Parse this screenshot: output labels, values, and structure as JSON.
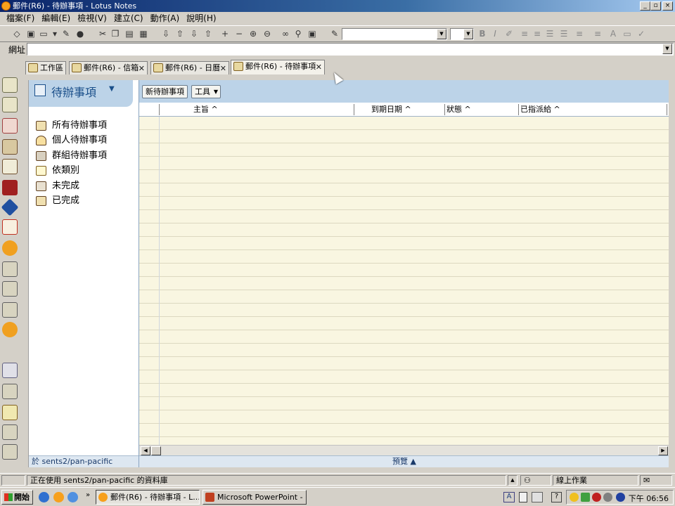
{
  "window": {
    "title": "郵件(R6) - 待辦事項 - Lotus Notes",
    "controls": [
      "_",
      "▫",
      "×"
    ]
  },
  "menu": [
    "檔案(F)",
    "編輯(E)",
    "檢視(V)",
    "建立(C)",
    "動作(A)",
    "說明(H)"
  ],
  "addressbar": {
    "label": "網址",
    "value": ""
  },
  "tabs": [
    {
      "label": "工作區",
      "closable": false,
      "active": false
    },
    {
      "label": "郵件(R6) - 信箱",
      "closable": true,
      "active": false
    },
    {
      "label": "郵件(R6) - 日曆",
      "closable": true,
      "active": false
    },
    {
      "label": "郵件(R6) - 待辦事項",
      "closable": true,
      "active": true
    }
  ],
  "navigator": {
    "title": "待辦事項",
    "items": [
      "所有待辦事項",
      "個人待辦事項",
      "群組待辦事項",
      "依類別",
      "未完成",
      "已完成"
    ],
    "footer": "於 sents2/pan-pacific"
  },
  "view": {
    "actions": [
      "新待辦事項",
      "工具"
    ],
    "columns": [
      "主旨",
      "到期日期",
      "狀態",
      "已指派給"
    ],
    "sort_arrow": "^",
    "preview_label": "預覽"
  },
  "status": {
    "message": "正在使用 sents2/pan-pacific 的資料庫",
    "mode": "線上作業"
  },
  "taskbar": {
    "start": "開始",
    "tasks": [
      {
        "label": "郵件(R6) - 待辦事項 - L...",
        "pressed": true
      },
      {
        "label": "Microsoft PowerPoint - [L...",
        "pressed": false
      }
    ],
    "clock": "下午 06:56"
  },
  "colors": {
    "titlebar": "#0a246a",
    "view_header": "#bcd3e8",
    "view_rows": "#f9f6e1",
    "chrome": "#d4d0c8"
  }
}
